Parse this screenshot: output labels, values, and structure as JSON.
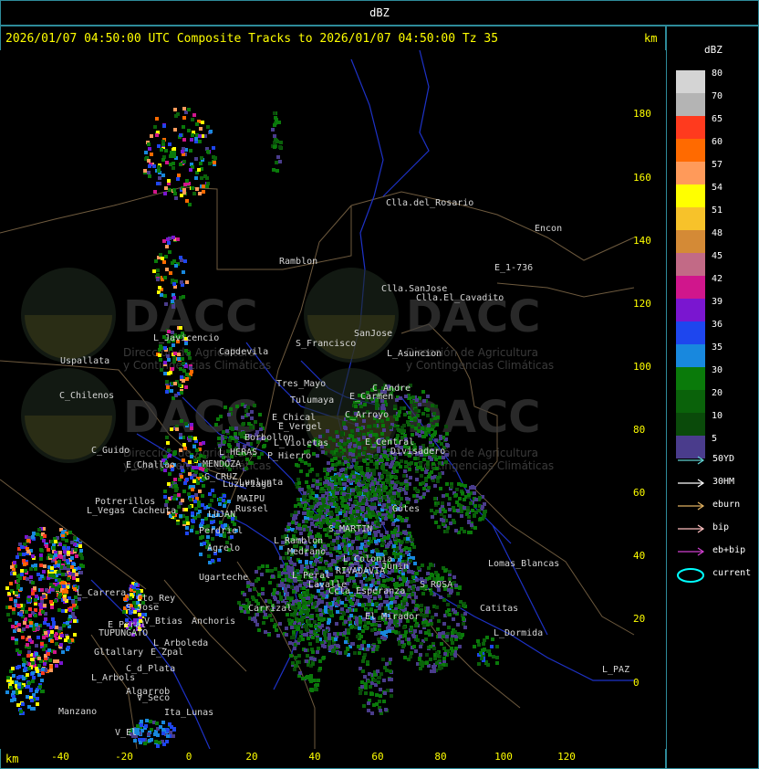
{
  "header": {
    "title": "dBZ"
  },
  "plot": {
    "title": "2026/01/07 04:50:00 UTC Composite Tracks to 2026/01/07 04:50:00 Tz 35",
    "y_unit": "km",
    "x_unit": "km",
    "y_ticks": [
      "180",
      "160",
      "140",
      "120",
      "100",
      "80",
      "60",
      "40",
      "20",
      "0"
    ],
    "x_ticks": [
      "-40",
      "-20",
      "0",
      "20",
      "40",
      "60",
      "80",
      "100",
      "120"
    ]
  },
  "watermark": {
    "name": "DACC",
    "subtitle_1": "Dirección de Agricultura",
    "subtitle_2": "y Contingencias Climáticas"
  },
  "places": [
    "Clla.del_Rosario",
    "Encon",
    "E_1-736",
    "Ramblon",
    "Clla.SanJose",
    "Clla.El_Cavadito",
    "L_Javicencio",
    "Capdevila",
    "S_Francisco",
    "SanJose",
    "L_Asuncion",
    "Uspallata",
    "Tres_Mayo",
    "C_Andre",
    "C_Chilenos",
    "Tulumaya",
    "E_Carmen",
    "E_Chical",
    "E_Vergel",
    "C_Arroyo",
    "Borbollon",
    "L_Violetas",
    "E_Central",
    "Divisadero",
    "L_HERAS",
    "P_Hierro",
    "C_Guido",
    "E_Challao",
    "MENDOZA",
    "G_CRUZ",
    "Lunlunta",
    "Luzuriaga",
    "MAIPU",
    "Russel",
    "LUJAN",
    "Potrerillos",
    "Cacheuta",
    "L_Vegas",
    "Perdriel",
    "Agrelo",
    "L_Ramblon",
    "Ugarteche",
    "Carrizal",
    "L_Carrera",
    "Cto_Rey",
    "S_Jose",
    "Anchoris",
    "E_Peral",
    "V_Btias",
    "TUPUNGATO",
    "L_Arboleda",
    "Gltallary",
    "E_Zpal",
    "C_d_Plata",
    "L_Arbols",
    "Algarrob",
    "V_Seco",
    "Ita_Lunas",
    "Manzano",
    "V_El",
    "Lomas_Blancas",
    "Catitas",
    "L_Dormida",
    "L_PAZ",
    "S_MARTIN",
    "RIVADAVIA",
    "Medrano",
    "L_Colonia",
    "Junin",
    "S_ROSA",
    "El_Mirador",
    "Ccla_Esperanza",
    "Lavalle",
    "L_Peral",
    "Gotes"
  ],
  "legend": {
    "title": "dBZ",
    "levels": [
      {
        "label": "80",
        "color": "#d4d4d4"
      },
      {
        "label": "70",
        "color": "#b4b4b4"
      },
      {
        "label": "65",
        "color": "#ff3a1e"
      },
      {
        "label": "60",
        "color": "#ff6a00"
      },
      {
        "label": "57",
        "color": "#ff9a5a"
      },
      {
        "label": "54",
        "color": "#ffff00"
      },
      {
        "label": "51",
        "color": "#f7c22a"
      },
      {
        "label": "48",
        "color": "#d48a36"
      },
      {
        "label": "45",
        "color": "#c26a86"
      },
      {
        "label": "42",
        "color": "#d0168c"
      },
      {
        "label": "39",
        "color": "#7a16d0"
      },
      {
        "label": "36",
        "color": "#1e46ee"
      },
      {
        "label": "35",
        "color": "#1888de"
      },
      {
        "label": "30",
        "color": "#0a7a0a"
      },
      {
        "label": "20",
        "color": "#0a620a"
      },
      {
        "label": "10",
        "color": "#0a4a0a"
      },
      {
        "label": "5",
        "color": "#4a3c8c"
      }
    ],
    "tracks": [
      {
        "label": "50YD",
        "color": "#5fd0d0"
      },
      {
        "label": "30HM",
        "color": "#ffffff"
      },
      {
        "label": "eburn",
        "color": "#e0b060"
      },
      {
        "label": "bip",
        "color": "#ffc0c0"
      },
      {
        "label": "eb+bip",
        "color": "#d040d0"
      },
      {
        "label": "current",
        "color": "#00ffff"
      }
    ]
  }
}
